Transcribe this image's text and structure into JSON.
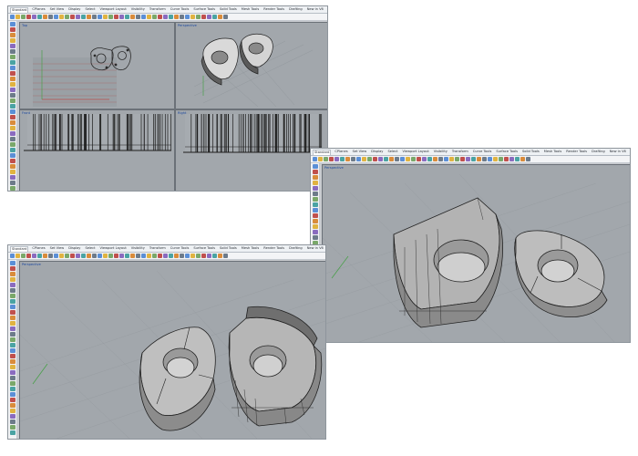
{
  "menu_tabs": [
    "Standard",
    "CPlanes",
    "Set View",
    "Display",
    "Select",
    "Viewport Layout",
    "Visibility",
    "Transform",
    "Curve Tools",
    "Surface Tools",
    "Solid Tools",
    "Mesh Tools",
    "Render Tools",
    "Drafting",
    "New in V6"
  ],
  "viewports": {
    "top": "Top",
    "perspective": "Perspective",
    "front": "Front",
    "right": "Right"
  },
  "toolbar_icon_colors": [
    "#5b8fd6",
    "#e0b341",
    "#7aa86a",
    "#c0504d",
    "#8a6bbf",
    "#4aa3a3",
    "#d98c3b",
    "#6d7b8a"
  ],
  "colors": {
    "viewport_bg": "#a2a7ac",
    "part_top_face": "#b9b9b9",
    "part_side_face": "#8d8d8d",
    "wire": "#2b2b2b",
    "axis_x": "#b84a4a",
    "axis_y": "#4aa04a"
  }
}
